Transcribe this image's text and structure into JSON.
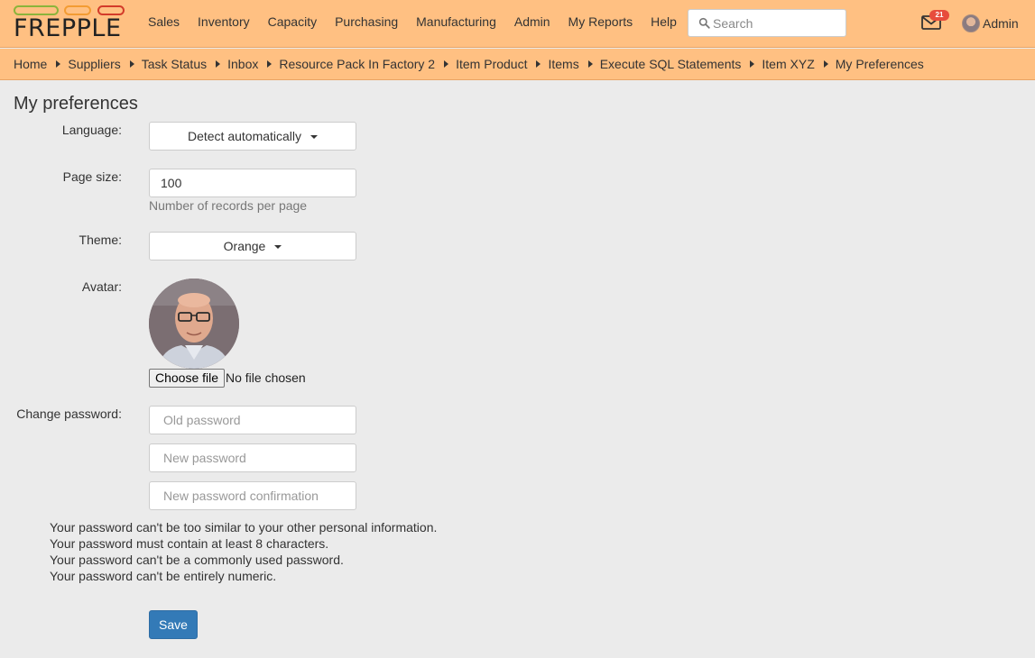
{
  "app": {
    "logo_text": "FREPPLE"
  },
  "nav": {
    "items": [
      "Sales",
      "Inventory",
      "Capacity",
      "Purchasing",
      "Manufacturing",
      "Admin",
      "My Reports",
      "Help"
    ]
  },
  "search": {
    "placeholder": "Search"
  },
  "inbox": {
    "count": "21"
  },
  "user": {
    "name": "Admin"
  },
  "breadcrumb": {
    "items": [
      "Home",
      "Suppliers",
      "Task Status",
      "Inbox",
      "Resource Pack In Factory 2",
      "Item Product",
      "Items",
      "Execute SQL Statements",
      "Item XYZ",
      "My Preferences"
    ]
  },
  "page": {
    "title": "My preferences"
  },
  "form": {
    "language_label": "Language:",
    "language_value": "Detect automatically",
    "pagesize_label": "Page size:",
    "pagesize_value": "100",
    "pagesize_help": "Number of records per page",
    "theme_label": "Theme:",
    "theme_value": "Orange",
    "avatar_label": "Avatar:",
    "file_button": "Choose file",
    "file_status": "No file chosen",
    "password_label": "Change password:",
    "old_password_placeholder": "Old password",
    "new_password_placeholder": "New password",
    "confirm_password_placeholder": "New password confirmation",
    "password_rules": [
      "Your password can't be too similar to your other personal information.",
      "Your password must contain at least 8 characters.",
      "Your password can't be a commonly used password.",
      "Your password can't be entirely numeric."
    ],
    "save_label": "Save"
  },
  "colors": {
    "header_bg": "#ffc082",
    "page_bg": "#ebebeb",
    "primary_button": "#337ab7",
    "badge": "#e74c3c"
  },
  "icons": {
    "search": "search-icon",
    "inbox": "envelope-icon",
    "caret": "caret-down-icon",
    "user": "user-avatar-icon"
  }
}
